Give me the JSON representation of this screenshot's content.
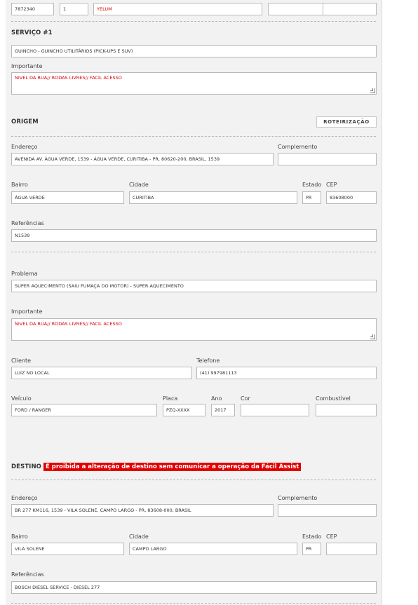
{
  "top": {
    "associado_value": "7872340",
    "ordem_value": "1",
    "produto_value": "YELUM",
    "data_value_1": "",
    "data_value_2": ""
  },
  "servico": {
    "title": "SERVIÇO #1",
    "service_value": "GUINCHO - GUINCHO UTILITÁRIOS (PICK-UPS E SUV)",
    "importante_label": "Importante",
    "importante_value": "NIVEL DA RUA// RODAS LIVRES// FACIL ACESSO"
  },
  "origem": {
    "title": "ORIGEM",
    "roteirizacao_label": "ROTEIRIZAÇÃO",
    "endereco_label": "Endereço",
    "endereco_value": "AVENIDA AV. ÁGUA VERDE, 1539 - ÁGUA VERDE, CURITIBA - PR, 80620-200, BRASIL, 1539",
    "complemento_label": "Complemento",
    "complemento_value": "",
    "bairro_label": "Bairro",
    "bairro_value": "ÁGUA VERDE",
    "cidade_label": "Cidade",
    "cidade_value": "CURITIBA",
    "estado_label": "Estado",
    "estado_value": "PR",
    "cep_label": "CEP",
    "cep_value": "83608000",
    "referencias_label": "Referências",
    "referencias_value": "N1539"
  },
  "ocorrencia": {
    "problema_label": "Problema",
    "problema_value": "SUPER AQUECIMENTO (SAIU FUMAÇA DO MOTOR) - SUPER AQUECIMENTO",
    "importante_label": "Importante",
    "importante_value": "NIVEL DA RUA// RODAS LIVRES// FACIL ACESSO",
    "cliente_label": "Cliente",
    "cliente_value": "LUIZ NO LOCAL",
    "telefone_label": "Telefone",
    "telefone_value": "(41) 997981113",
    "veiculo_label": "Veículo",
    "veiculo_value": "FORD / RANGER",
    "placa_label": "Placa",
    "placa_value": "PZQ-XXXX",
    "ano_label": "Ano",
    "ano_value": "2017",
    "cor_label": "Cor",
    "cor_value": "",
    "combustivel_label": "Combustível",
    "combustivel_value": ""
  },
  "destino": {
    "title": "DESTINO",
    "warning": "É proibida a alteração de destino sem comunicar a operação da Fácil Assist",
    "endereco_label": "Endereço",
    "endereco_value": "BR 277 KM116, 1539 - VILA SOLENE, CAMPO LARGO - PR, 83608-000, BRASIL",
    "complemento_label": "Complemento",
    "complemento_value": "",
    "bairro_label": "Bairro",
    "bairro_value": "VILA SOLENE",
    "cidade_label": "Cidade",
    "cidade_value": "CAMPO LARGO",
    "estado_label": "Estado",
    "estado_value": "PR",
    "cep_label": "CEP",
    "cep_value": "",
    "referencias_label": "Referências",
    "referencias_value": "BOSCH DIESEL SERVICE - DIESEL 277"
  },
  "colors": {
    "panel_bg": "#f2f2f2",
    "warning_bg": "#e10000",
    "important_text": "#d40000"
  }
}
